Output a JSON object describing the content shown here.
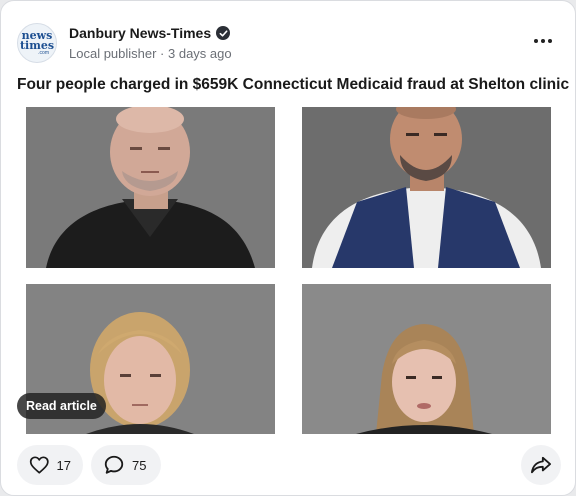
{
  "publisher": {
    "logo_line1": "news",
    "logo_line2": "times",
    "logo_line3": ".com",
    "name": "Danbury News-Times",
    "meta": "Local publisher · 3 days ago"
  },
  "article": {
    "headline": "Four people charged in $659K Connecticut Medicaid fraud at Shelton clinic",
    "read_article_label": "Read article"
  },
  "actions": {
    "likes": "17",
    "comments": "75"
  },
  "icons": {
    "verified": "verified-badge-icon",
    "more": "more-options-icon",
    "like": "heart-icon",
    "comment": "comment-bubble-icon",
    "share": "share-arrow-icon"
  },
  "colors": {
    "logo_blue": "#1d4f91",
    "card_bg": "#ffffff",
    "pill_bg": "#f1f2f4"
  }
}
